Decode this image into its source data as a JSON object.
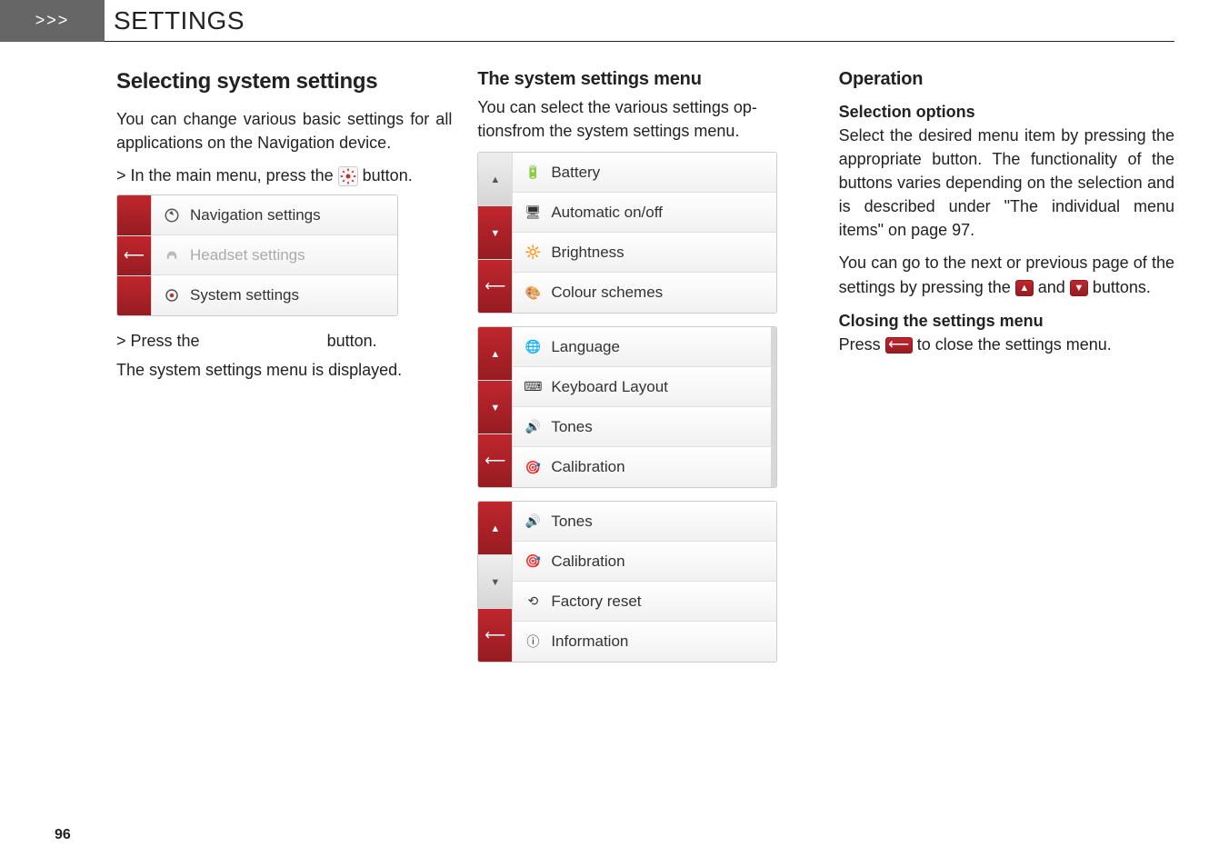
{
  "header": {
    "chevrons": ">>>",
    "title": "SETTINGS"
  },
  "page_number": "96",
  "col1": {
    "heading": "Selecting system settings",
    "p1": "You can change various basic settings for all applications on the Navigation device.",
    "step1a": "> In the main menu, press the ",
    "step1b": " but­ton.",
    "menu1": {
      "item1": "Navigation settings",
      "item2": "Headset settings",
      "item3": "System settings"
    },
    "step2a": "> Press the ",
    "step2b": " button.",
    "p2": "The system settings menu is displayed."
  },
  "col2": {
    "heading": "The system settings menu",
    "p1": "You can select the various settings op­tionsfrom the system settings menu.",
    "menuA": {
      "i1": "Battery",
      "i2": "Automatic on/off",
      "i3": "Brightness",
      "i4": "Colour schemes"
    },
    "menuB": {
      "i1": "Language",
      "i2": "Keyboard Layout",
      "i3": "Tones",
      "i4": "Calibration"
    },
    "menuC": {
      "i1": "Tones",
      "i2": "Calibration",
      "i3": "Factory reset",
      "i4": "Information"
    }
  },
  "col3": {
    "heading": "Operation",
    "sub1": "Selection options",
    "p1": "Select the desired menu item by press­ing the appropriate button. The function­ality of the buttons varies depending on the selection and is described under \"The individual menu items\" on page 97.",
    "p2a": "You can go to the next or previous page of the settings by pressing the ",
    "p2b": " and ",
    "p2c": " buttons.",
    "sub2": "Closing the settings menu",
    "p3a": "Press ",
    "p3b": " to close the settings menu."
  }
}
